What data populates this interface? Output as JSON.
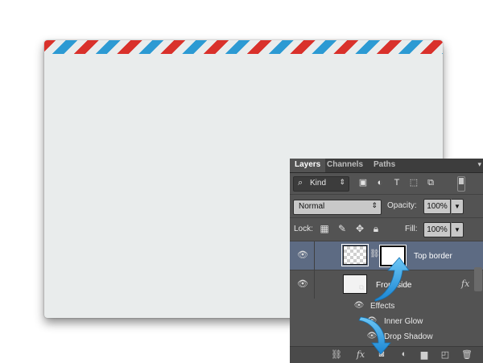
{
  "tabs": {
    "layers": "Layers",
    "channels": "Channels",
    "paths": "Paths"
  },
  "filter": {
    "kind_label": "Kind",
    "icons": [
      "image-filter-icon",
      "adjustment-filter-icon",
      "type-filter-icon",
      "shape-filter-icon",
      "smart-object-filter-icon"
    ]
  },
  "blend": {
    "mode": "Normal",
    "opacity_label": "Opacity:",
    "opacity_value": "100%"
  },
  "lock": {
    "label": "Lock:",
    "fill_label": "Fill:",
    "fill_value": "100%"
  },
  "layers": [
    {
      "name": "Top border",
      "selected": true
    },
    {
      "name": "Front side",
      "selected": false
    }
  ],
  "effects": {
    "header": "Effects",
    "items": [
      "Inner Glow",
      "Drop Shadow"
    ]
  },
  "fx_symbol": "fx",
  "colors": {
    "stripe_red": "#d9312b",
    "stripe_blue": "#2c9ad3",
    "selection": "#5d6b83",
    "arrow": "#2a9be0"
  }
}
